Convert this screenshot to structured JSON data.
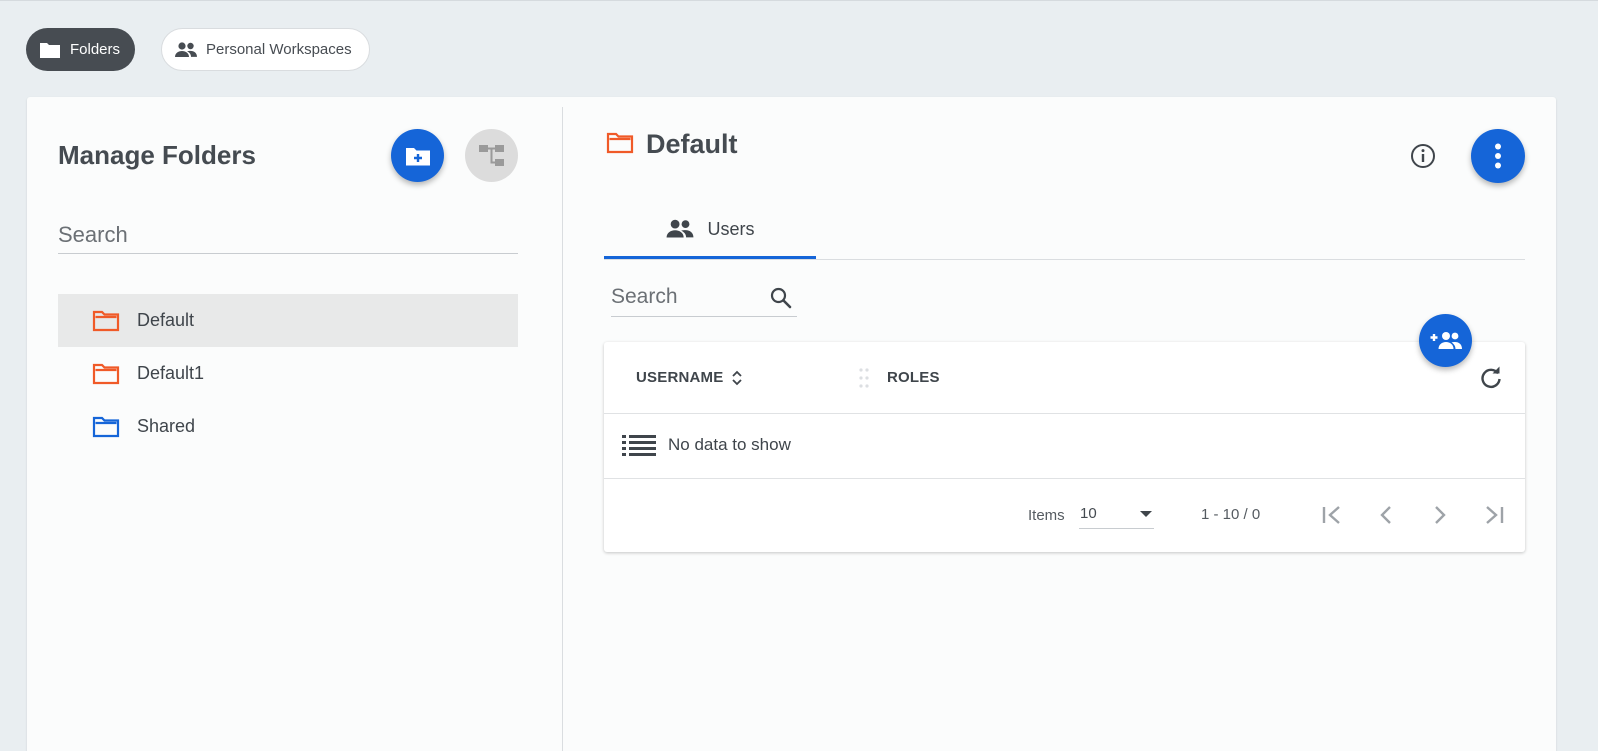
{
  "nav": {
    "folders_label": "Folders",
    "workspaces_label": "Personal Workspaces"
  },
  "left": {
    "title": "Manage Folders",
    "search_placeholder": "Search",
    "folders": [
      {
        "label": "Default",
        "color": "#f05a28",
        "selected": true
      },
      {
        "label": "Default1",
        "color": "#f05a28",
        "selected": false
      },
      {
        "label": "Shared",
        "color": "#1565d8",
        "selected": false
      }
    ]
  },
  "right": {
    "title": "Default",
    "title_icon_color": "#f05a28",
    "tabs": [
      {
        "label": "Users",
        "active": true
      }
    ],
    "search_placeholder": "Search",
    "table": {
      "columns": [
        "USERNAME",
        "ROLES"
      ],
      "empty_text": "No data to show"
    },
    "pager": {
      "items_label": "Items",
      "page_size": "10",
      "range": "1 - 10 / 0"
    }
  },
  "colors": {
    "accent": "#1565d8",
    "folder_orange": "#f05a28",
    "background": "#e9eef1"
  },
  "icons": {
    "folders_chip": "folder-icon",
    "workspaces_chip": "people-icon",
    "add_folder": "folder-plus-icon",
    "tree": "tree-icon",
    "more": "more-vertical-icon",
    "info": "info-icon",
    "add_user": "add-group-icon",
    "refresh": "refresh-icon"
  }
}
